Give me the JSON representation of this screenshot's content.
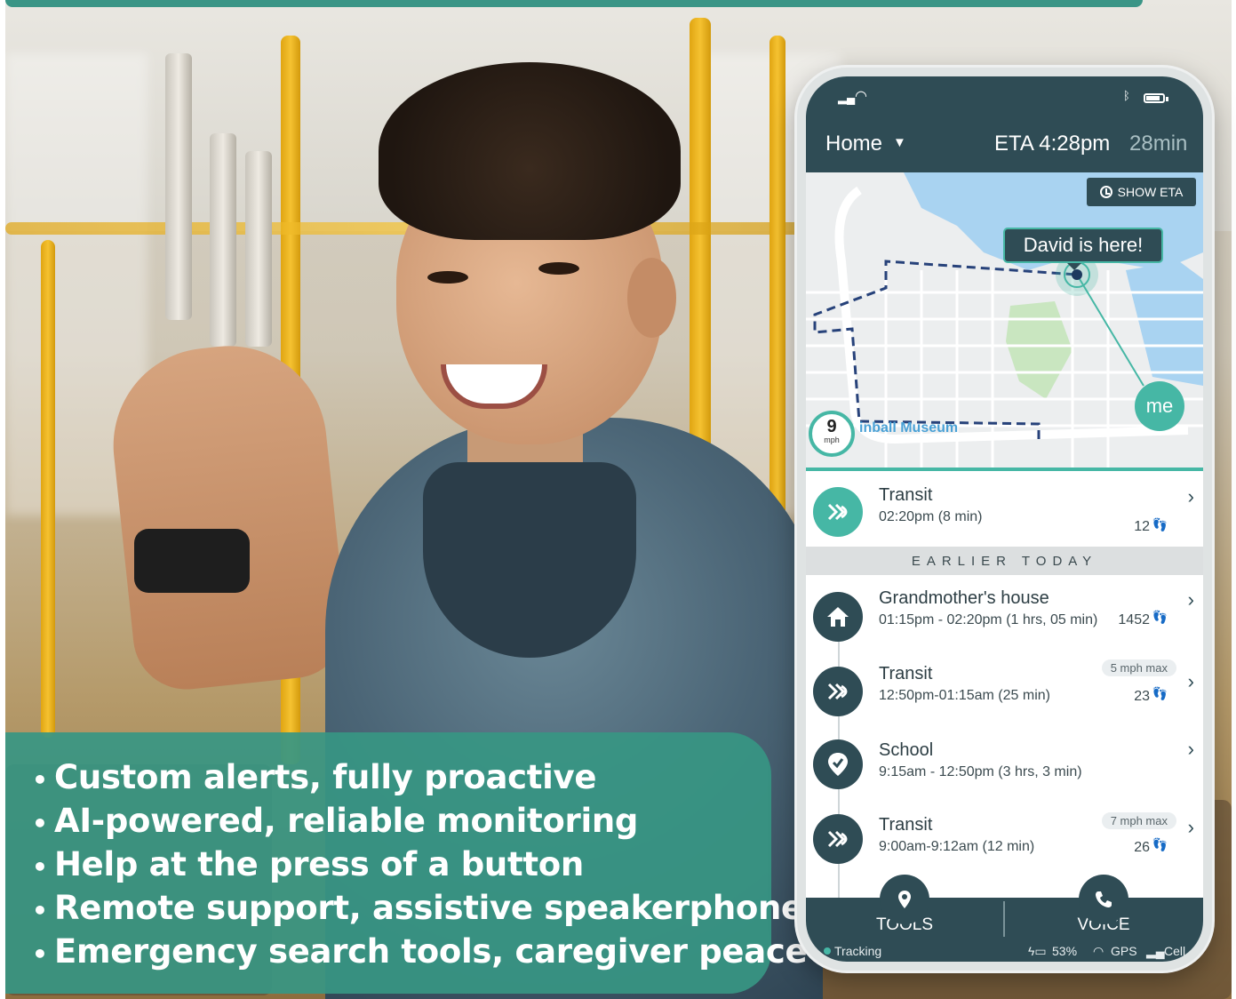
{
  "features": [
    "Custom alerts, fully proactive",
    "AI-powered, reliable monitoring",
    "Help at the press of a button",
    "Remote support, assistive speakerphone",
    "Emergency search tools, caregiver peace"
  ],
  "header": {
    "destination": "Home",
    "eta": "ETA 4:28pm",
    "eta_minutes": "28min"
  },
  "map": {
    "show_eta_label": "SHOW ETA",
    "location_bubble": "David is here!",
    "me_label": "me",
    "speed_value": "9",
    "speed_unit": "mph",
    "street_label": "inball Museum"
  },
  "current": {
    "title": "Transit",
    "subtitle": "02:20pm (8 min)",
    "steps": "12"
  },
  "section_label": "EARLIER TODAY",
  "history": [
    {
      "title": "Grandmother's house",
      "subtitle": "01:15pm - 02:20pm (1 hrs, 05 min)",
      "steps": "1452",
      "badge": "",
      "icon": "home-icon"
    },
    {
      "title": "Transit",
      "subtitle": "12:50pm-01:15am (25 min)",
      "steps": "23",
      "badge": "5 mph max",
      "icon": "transit-icon"
    },
    {
      "title": "School",
      "subtitle": "9:15am - 12:50pm (3 hrs, 3 min)",
      "steps": "",
      "badge": "",
      "icon": "check-icon"
    },
    {
      "title": "Transit",
      "subtitle": "9:00am-9:12am (12 min)",
      "steps": "26",
      "badge": "7 mph max",
      "icon": "transit-icon"
    }
  ],
  "nav": {
    "tools_label": "TOOLS",
    "voice_label": "VOICE"
  },
  "status": {
    "tracking": "Tracking",
    "battery": "53%",
    "gps": "GPS",
    "cell": "Cell"
  },
  "colors": {
    "teal": "#46b7a5",
    "dark": "#2f4c55",
    "panel": "#379683"
  }
}
